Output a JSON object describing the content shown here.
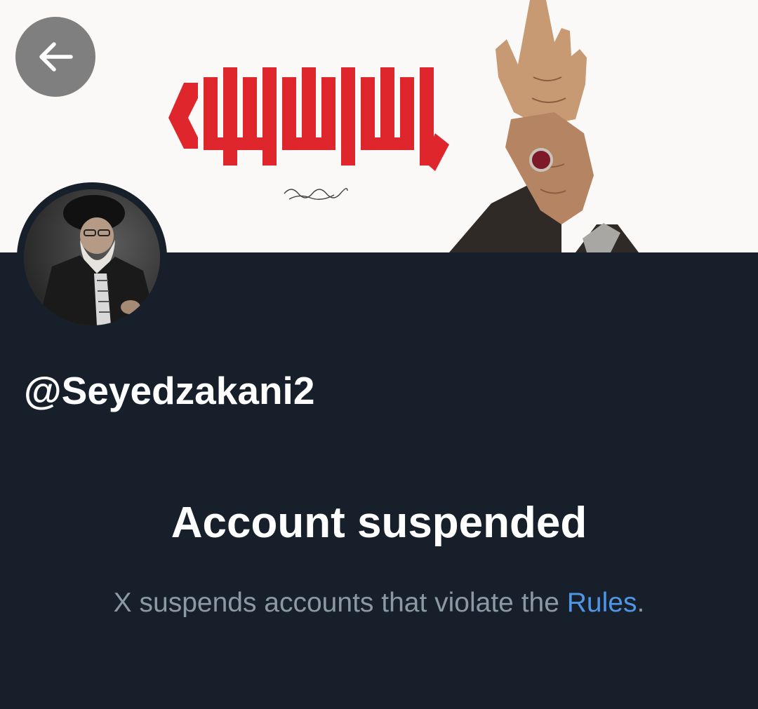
{
  "header": {
    "back_icon": "arrow-left-icon"
  },
  "banner": {
    "background_color": "#fbf9f7",
    "calligraphy_color": "#e0262d",
    "kufic_text": "لا اله الا الله",
    "signature_text": "آیة الله العظمی سید علی خامنه ای"
  },
  "profile": {
    "handle": "@Seyedzakani2"
  },
  "suspension": {
    "title": "Account suspended",
    "message_prefix": "X suspends accounts that violate the ",
    "rules_link": "Rules",
    "message_suffix": "."
  },
  "colors": {
    "background": "#17202a",
    "primary_text": "#ffffff",
    "secondary_text": "#8b98a5",
    "link": "#4f97e6"
  }
}
